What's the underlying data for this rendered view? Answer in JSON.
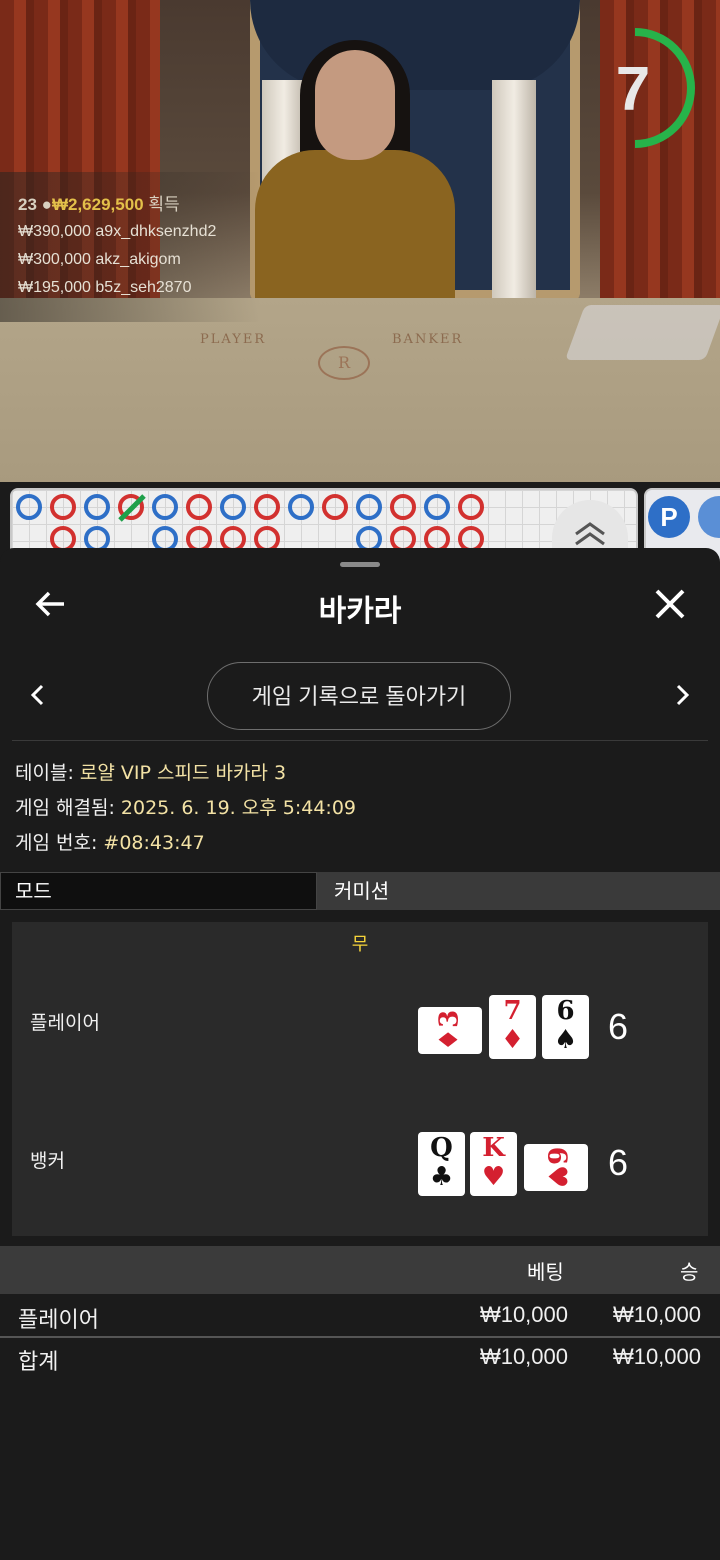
{
  "video": {
    "countdown": "7",
    "felt_player": "PLAYER",
    "felt_banker": "BANKER",
    "felt_logo": "R",
    "winners": {
      "count": "23",
      "total": "₩2,629,500",
      "label": "획득",
      "rows": [
        {
          "amount": "₩390,000",
          "user": "a9x_dhksenzhd2"
        },
        {
          "amount": "₩300,000",
          "user": "akz_akigom"
        },
        {
          "amount": "₩195,000",
          "user": "b5z_seh2870"
        }
      ]
    },
    "badge_p": "P",
    "colors": {
      "banker": "#d2312f",
      "player": "#2e6fc7",
      "countdown": "#27b34a"
    }
  },
  "sheet": {
    "title": "바카라",
    "back_icon": "arrow-left-icon",
    "close_icon": "close-icon",
    "return_button": "게임 기록으로 돌아가기",
    "info": {
      "table_label": "테이블:",
      "table_value": "로얄 VIP 스피드 바카라 3",
      "resolved_label": "게임 해결됨:",
      "resolved_value": "2025. 6. 19. 오후 5:44:09",
      "number_label": "게임 번호:",
      "number_value": "#08:43:47"
    },
    "tabs": {
      "mode": "모드",
      "commission": "커미션"
    },
    "result": {
      "outcome": "무",
      "player": {
        "label": "플레이어",
        "score": "6",
        "cards": [
          {
            "rank": "3",
            "suit": "♦",
            "color": "red",
            "sideways": true
          },
          {
            "rank": "7",
            "suit": "♦",
            "color": "red",
            "sideways": false
          },
          {
            "rank": "6",
            "suit": "♠",
            "color": "black",
            "sideways": false
          }
        ]
      },
      "banker": {
        "label": "뱅커",
        "score": "6",
        "cards": [
          {
            "rank": "Q",
            "suit": "♣",
            "color": "black",
            "sideways": false
          },
          {
            "rank": "K",
            "suit": "♥",
            "color": "red",
            "sideways": false
          },
          {
            "rank": "6",
            "suit": "♥",
            "color": "red",
            "sideways": true
          }
        ]
      }
    },
    "bets": {
      "header_bet": "베팅",
      "header_win": "승",
      "rows": [
        {
          "name": "플레이어",
          "bet": "₩10,000",
          "win": "₩10,000"
        }
      ],
      "total": {
        "name": "합계",
        "bet": "₩10,000",
        "win": "₩10,000"
      }
    }
  }
}
